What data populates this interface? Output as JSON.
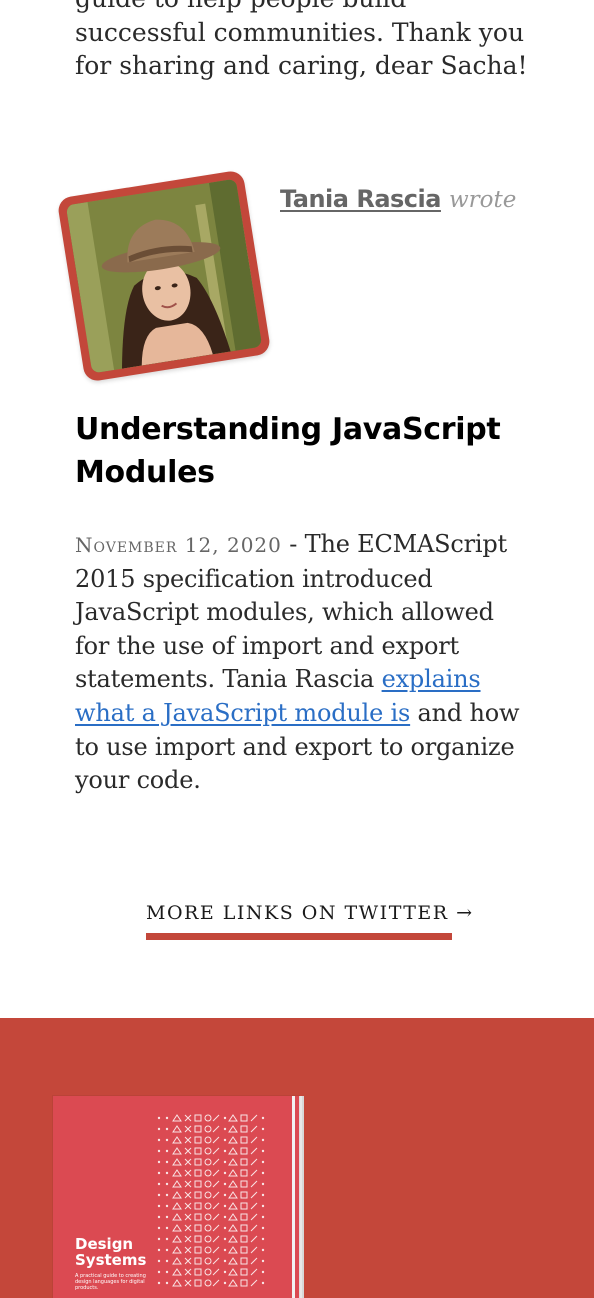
{
  "intro": {
    "text": "guide to help people build successful communities. Thank you for sharing and caring, dear Sacha!"
  },
  "post": {
    "author_name": "Tania Rascia",
    "author_verb": "wrote",
    "avatar_alt": "Tania Rascia avatar",
    "title": "Understanding JavaScript Modules",
    "date": "November 12, 2020",
    "separator": " - ",
    "body_before_link": "The ECMAScript 2015 specification introduced JavaScript modules, which allowed for the use of import and export statements. Tania Rascia ",
    "link_text": "explains what a JavaScript module is",
    "body_after_link": " and how to use import and export to organize your code."
  },
  "more_links": {
    "label": "MORE LINKS ON TWITTER →"
  },
  "footer": {
    "book_title": "Design Systems",
    "book_subtitle": "A practical guide to creating design languages for digital products."
  },
  "colors": {
    "accent": "#c3473a",
    "link": "#2a6ec5",
    "book_cover": "#db4a52"
  }
}
